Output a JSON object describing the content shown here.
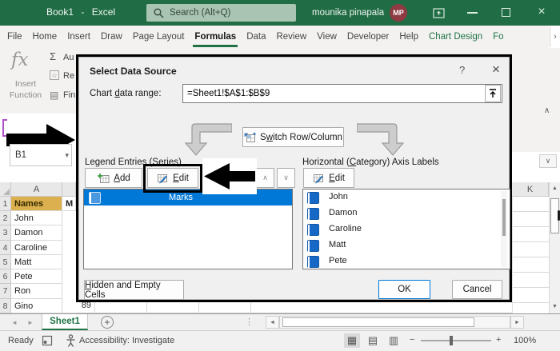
{
  "titlebar": {
    "title_doc": "Book1",
    "title_sep": "-",
    "title_app": "Excel",
    "search_placeholder": "Search (Alt+Q)",
    "user_name": "mounika pinapala",
    "avatar_initials": "MP"
  },
  "ribbon": {
    "tabs": [
      "File",
      "Home",
      "Insert",
      "Draw",
      "Page Layout",
      "Formulas",
      "Data",
      "Review",
      "View",
      "Developer",
      "Help",
      "Chart Design",
      "Fo"
    ],
    "active_tab": "Formulas",
    "overflow_chevron": "›",
    "collapse_chevron": "∧",
    "function_library": {
      "fx": "fx",
      "insert_function": "Insert Function",
      "sigma": "Σ",
      "autosum": "Au",
      "recent": "Re",
      "financial": "Fin",
      "star": "☆",
      "book": "▤"
    }
  },
  "formula_bar": {
    "name_box": "B1",
    "dropdown": "▾",
    "expand_chevron": "∨"
  },
  "dialog": {
    "title": "Select Data Source",
    "help": "?",
    "close": "×",
    "range_label": {
      "pre": "Chart ",
      "key": "d",
      "post": "ata range:"
    },
    "range_value": "=Sheet1!$A$1:$B$9",
    "switch_label": {
      "pre": "S",
      "key": "w",
      "post": "itch Row/Column"
    },
    "legend_label": {
      "pre": "Legend Entries (",
      "key": "S",
      "post": "eries)"
    },
    "category_label": {
      "pre": "Horizontal (",
      "key": "C",
      "post": "ategory) Axis Labels"
    },
    "add_label": {
      "pre": "",
      "key": "A",
      "post": "dd"
    },
    "edit_label": {
      "pre": "",
      "key": "E",
      "post": "dit"
    },
    "edit2_label": {
      "pre": "",
      "key": "E",
      "post": "dit"
    },
    "up_chevron": "∧",
    "down_chevron": "∨",
    "legend_items": [
      {
        "label": "Marks"
      }
    ],
    "category_items": [
      "John",
      "Damon",
      "Caroline",
      "Matt",
      "Pete"
    ],
    "hidden_label": {
      "pre": "",
      "key": "H",
      "post": "idden and Empty Cells"
    },
    "ok_label": "OK",
    "cancel_label": "Cancel"
  },
  "grid": {
    "col_a": "A",
    "col_b_clip": "M",
    "col_k": "K",
    "rows": [
      {
        "n": "1",
        "a": "Names"
      },
      {
        "n": "2",
        "a": "John"
      },
      {
        "n": "3",
        "a": "Damon"
      },
      {
        "n": "4",
        "a": "Caroline"
      },
      {
        "n": "5",
        "a": "Matt"
      },
      {
        "n": "6",
        "a": "Pete"
      },
      {
        "n": "7",
        "a": "Ron"
      },
      {
        "n": "8",
        "a": "Gino"
      }
    ],
    "row8_b": "89"
  },
  "sheet_bar": {
    "prev": "◄",
    "next": "►",
    "tab": "Sheet1",
    "add": "+",
    "splitter": "⋮",
    "h_left": "◄",
    "h_right": "►"
  },
  "scrollbar": {
    "up": "▲",
    "down": "▼"
  },
  "status_bar": {
    "ready": "Ready",
    "accessibility": "Accessibility: Investigate",
    "views": [
      "▦",
      "▤",
      "▥"
    ],
    "zoom_out": "−",
    "zoom_in": "+",
    "zoom_level": "100%"
  },
  "colors": {
    "titlebar_green": "#206c44",
    "accent_green": "#217346",
    "selection_blue": "#0078d7",
    "checkbox_blue": "#1568c5",
    "ok_border": "#0078d7",
    "a1_fill": "#ddb04f",
    "avatar_maroon": "#8e3b44"
  }
}
